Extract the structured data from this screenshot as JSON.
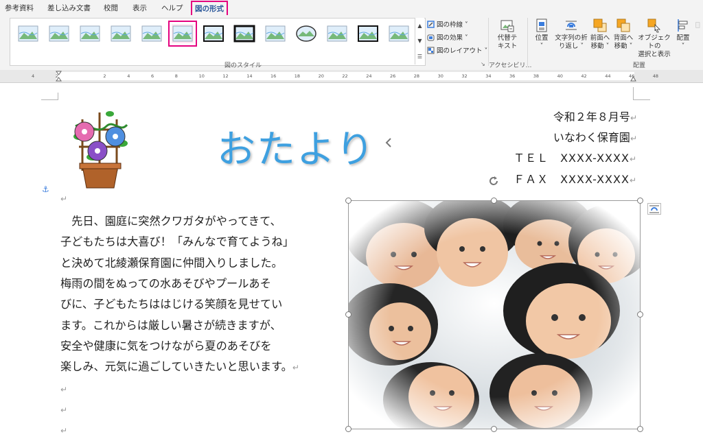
{
  "ribbon": {
    "tabs": [
      {
        "label": "参考資料"
      },
      {
        "label": "差し込み文書"
      },
      {
        "label": "校閲"
      },
      {
        "label": "表示"
      },
      {
        "label": "ヘルプ"
      },
      {
        "label": "図の形式",
        "active": true
      }
    ],
    "picture_options": {
      "border": "図の枠線 ˅",
      "effects": "図の効果 ˅",
      "layout": "図のレイアウト ˅"
    },
    "group_styles": "図のスタイル",
    "alt_text": {
      "line1": "代替テ",
      "line2": "キスト"
    },
    "group_accessibility": "アクセシビリ…",
    "position": {
      "line1": "位置",
      "line2": "˅"
    },
    "wrap": {
      "line1": "文字列の折",
      "line2": "り返し ˅"
    },
    "bring_forward": {
      "line1": "前面へ",
      "line2": "移動 ˅"
    },
    "send_backward": {
      "line1": "背面へ",
      "line2": "移動 ˅"
    },
    "selection_pane": {
      "line1": "オブジェクトの",
      "line2": "選択と表示"
    },
    "align": {
      "line1": "配置",
      "line2": "˅"
    },
    "group_arrange": "配置",
    "selected_style_index": 5
  },
  "ruler": {
    "ticks": [
      "4",
      "2",
      "",
      "2",
      "4",
      "6",
      "8",
      "10",
      "12",
      "14",
      "16",
      "18",
      "20",
      "22",
      "24",
      "26",
      "28",
      "30",
      "32",
      "34",
      "36",
      "38",
      "40",
      "42",
      "44",
      "46",
      "48"
    ]
  },
  "document": {
    "title": "おたより",
    "header_lines": [
      "令和２年８月号",
      "いなわく保育園",
      "ＴＥＬ　XXXX-XXXX",
      "ＦＡＸ　XXXX-XXXX"
    ],
    "body_lines": [
      "　先日、園庭に突然クワガタがやってきて、",
      "子どもたちは大喜び！「みんなで育てようね」",
      "と決めて北綾瀬保育園に仲間入りしました。",
      "梅雨の間をぬっての水あそびやプールあそ",
      "びに、子どもたちははじける笑顔を見せてい",
      "ます。これからは厳しい暑さが続きますが、",
      "安全や健康に気をつけながら夏のあそびを",
      "楽しみ、元気に過ごしていきたいと思います。"
    ]
  },
  "colors": {
    "accent": "#e4007f",
    "title": "#3ea0e0",
    "tab_active": "#2b579a"
  }
}
